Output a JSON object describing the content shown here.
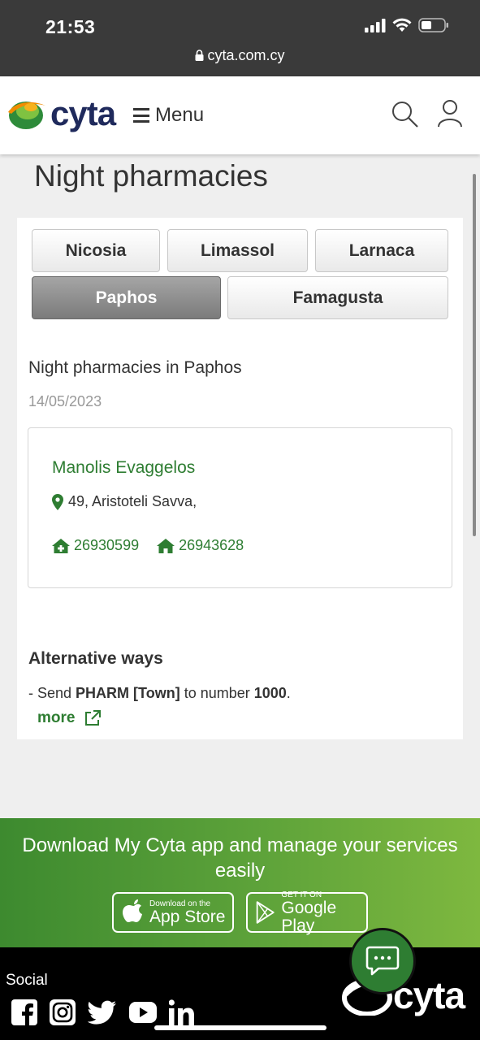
{
  "status_bar": {
    "time": "21:53",
    "url": "cyta.com.cy"
  },
  "header": {
    "logo_text": "cyta",
    "menu_label": "Menu"
  },
  "page": {
    "title": "Night pharmacies"
  },
  "tabs": [
    {
      "label": "Nicosia",
      "active": false
    },
    {
      "label": "Limassol",
      "active": false
    },
    {
      "label": "Larnaca",
      "active": false
    },
    {
      "label": "Paphos",
      "active": true
    },
    {
      "label": "Famagusta",
      "active": false
    }
  ],
  "results": {
    "subtitle": "Night pharmacies in Paphos",
    "date": "14/05/2023",
    "pharmacies": [
      {
        "name": "Manolis Evaggelos",
        "address": "49, Aristoteli Savva,",
        "phone_work": "26930599",
        "phone_home": "26943628"
      }
    ]
  },
  "alternative": {
    "title": "Alternative ways",
    "text_prefix": "- Send ",
    "text_code": "PHARM [Town]",
    "text_middle": " to number ",
    "text_number": "1000",
    "text_suffix": ".",
    "more_label": "more"
  },
  "promo": {
    "text": "Download My Cyta app and manage your services easily",
    "app_store_small": "Download on the",
    "app_store_big": "App Store",
    "google_play_small": "GET IT ON",
    "google_play_big": "Google Play"
  },
  "footer": {
    "social_label": "Social",
    "logo_text": "cyta"
  },
  "colors": {
    "brand_green": "#2e7d32",
    "brand_navy": "#1f2a5c",
    "status_bar": "#3a3a3a"
  }
}
